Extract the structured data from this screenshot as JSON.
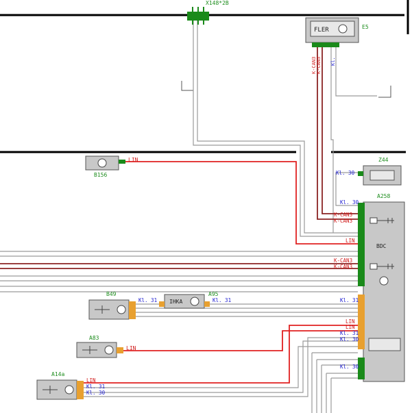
{
  "colors": {
    "component_fill": "#c8c8c8",
    "component_stroke": "#555555",
    "can_wire": "#8b2323",
    "lin_wire": "#e02020",
    "signal_wire": "#9a9a9a",
    "pin_green": "#1a8a1a",
    "pin_orange": "#e8a030",
    "label_green": "#1c8c1c",
    "label_blue": "#1a1ad0",
    "label_red": "#d01818",
    "bus_black": "#000000"
  },
  "connector_top": {
    "label": "X148*2B"
  },
  "components": {
    "e5": {
      "id": "E5",
      "inner": "FLER",
      "pin_labels": [
        "K-CAN3",
        "K-CAN3",
        "Kl."
      ]
    },
    "z44": {
      "id": "Z44",
      "pin_labels": [
        "Kl. 30"
      ]
    },
    "b156": {
      "id": "B156",
      "pin_labels": [
        "LIN"
      ]
    },
    "a258": {
      "id": "A258",
      "inner": "BDC",
      "pin_labels": [
        "Kl. 30",
        "K-CAN3",
        "K-CAN3",
        "LIN",
        "K-CAN3",
        "K-CAN3",
        "Kl. 31",
        "LIN",
        "LIN",
        "Kl. 31",
        "Kl. 30",
        "Kl. 30"
      ]
    },
    "b49": {
      "id": "B49",
      "pin_labels": [
        "Kl. 31"
      ]
    },
    "a95": {
      "id": "A95",
      "inner": "IHKA",
      "pin_labels": [
        "Kl. 31"
      ]
    },
    "a83": {
      "id": "A83",
      "pin_labels": [
        "LIN"
      ]
    },
    "a14a": {
      "id": "A14a",
      "pin_labels": [
        "LIN",
        "Kl. 31",
        "Kl. 30"
      ]
    }
  }
}
